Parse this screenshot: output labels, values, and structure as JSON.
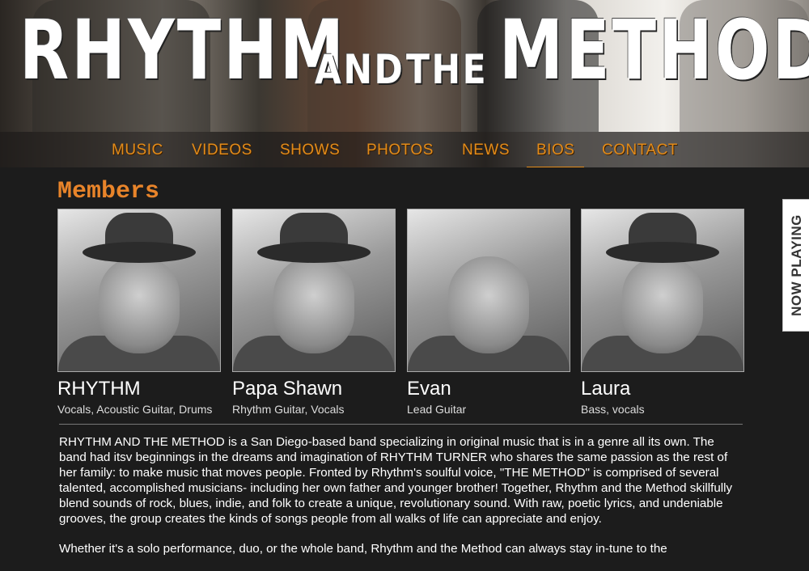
{
  "banner": {
    "logo_part1": "RHYTHM",
    "logo_part2": "AND",
    "logo_part3": "THE",
    "logo_part4": "METHOD"
  },
  "nav": {
    "items": [
      {
        "label": "MUSIC"
      },
      {
        "label": "VIDEOS"
      },
      {
        "label": "SHOWS"
      },
      {
        "label": "PHOTOS"
      },
      {
        "label": "NEWS"
      },
      {
        "label": "BIOS",
        "active": true
      },
      {
        "label": "CONTACT"
      }
    ],
    "accent_color": "#e28b1a"
  },
  "main": {
    "title": "Members",
    "members": [
      {
        "name": "RHYTHM",
        "role": "Vocals, Acoustic Guitar, Drums"
      },
      {
        "name": "Papa Shawn",
        "role": "Rhythm Guitar, Vocals"
      },
      {
        "name": "Evan",
        "role": "Lead Guitar"
      },
      {
        "name": "Laura",
        "role": "Bass, vocals"
      }
    ],
    "bio": [
      "RHYTHM AND THE METHOD is a San Diego-based band specializing in original music that is in a genre all its own. The band had itsv beginnings in the dreams and imagination of RHYTHM TURNER who shares the same passion as the rest of her family: to make music that moves people. Fronted by Rhythm's soulful voice, \"THE METHOD\" is comprised of several talented, accomplished musicians- including her own father and younger brother! Together, Rhythm and the Method skillfully blend sounds of rock, blues, indie, and folk to create a unique, revolutionary sound. With raw, poetic lyrics, and undeniable grooves, the group creates the kinds of songs people from all walks of life can appreciate and enjoy.",
      "Whether it's a solo performance, duo, or the whole band, Rhythm and the Method can always stay in-tune to the"
    ]
  },
  "now_playing": {
    "label": "NOW PLAYING"
  },
  "colors": {
    "background": "#1c1c1c",
    "title": "#e8842a"
  }
}
